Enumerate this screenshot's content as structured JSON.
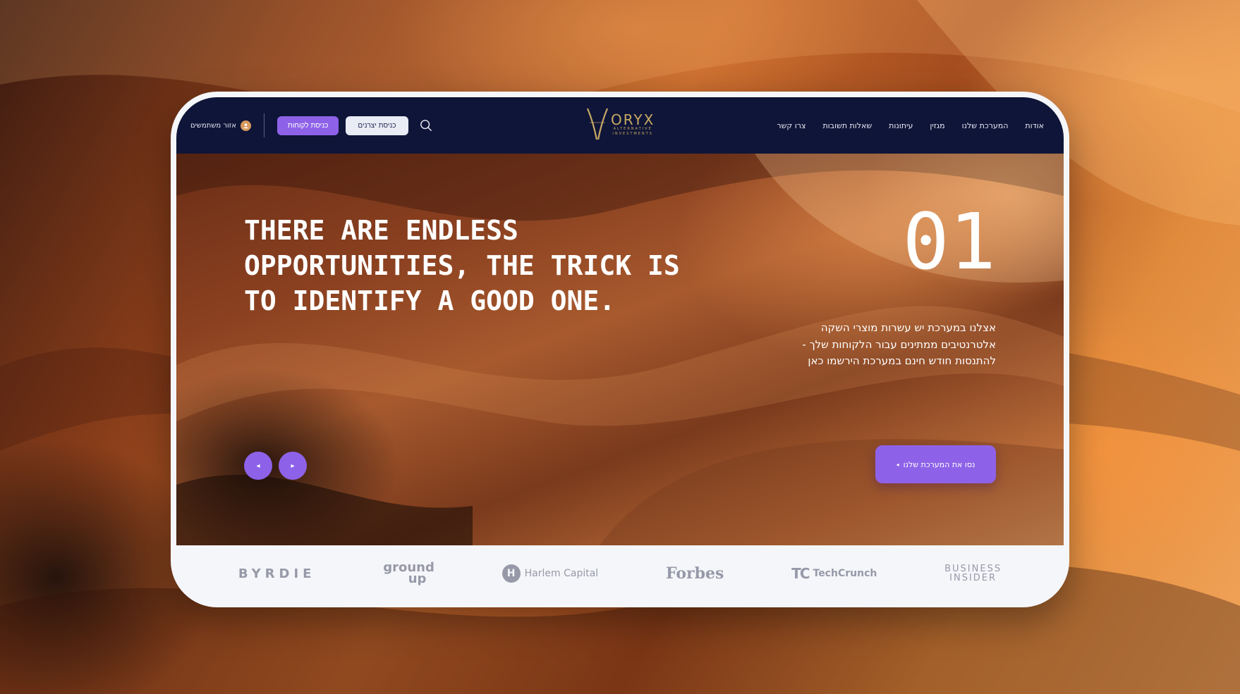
{
  "nav": {
    "user_area_label": "אזור משתמשים",
    "clients_login_label": "כניסת לקוחות",
    "producers_login_label": "כניסת יצרנים",
    "logo": {
      "name": "ORYX",
      "tagline": "ALTERNATIVE INVESTMENTS"
    },
    "links": [
      {
        "label": "אודות"
      },
      {
        "label": "המערכת שלנו"
      },
      {
        "label": "מגזין"
      },
      {
        "label": "עיתונות"
      },
      {
        "label": "שאלות תשובות"
      },
      {
        "label": "צרו קשר"
      }
    ]
  },
  "hero": {
    "headline": "THERE ARE ENDLESS OPPORTUNITIES, THE TRICK IS TO IDENTIFY A GOOD ONE.",
    "slide_number": "01",
    "text_lines": [
      "אצלנו במערכת יש עשרות מוצרי השקה",
      "אלטרנטיבים ממתינים עבור הלקוחות שלך -",
      "להתנסות חודש חינם במערכת הירשמו כאן"
    ],
    "cta_label": "נסו את המערכת שלנו",
    "cta_arrow": "◂",
    "prev_arrow": "◂",
    "next_arrow": "▸"
  },
  "partners": {
    "byrdie": "BYRDIE",
    "groundup_1": "ground",
    "groundup_2": "up",
    "harlem_mark": "H",
    "harlem": "Harlem Capital",
    "forbes": "Forbes",
    "techcrunch_mark": "TC",
    "techcrunch": "TechCrunch",
    "bi_1": "BUSINESS",
    "bi_2": "INSIDER"
  },
  "colors": {
    "navbar": "#0f1538",
    "accent_purple": "#8e62e8",
    "logo_gold": "#c8a964",
    "frame": "#f5f6fa"
  }
}
